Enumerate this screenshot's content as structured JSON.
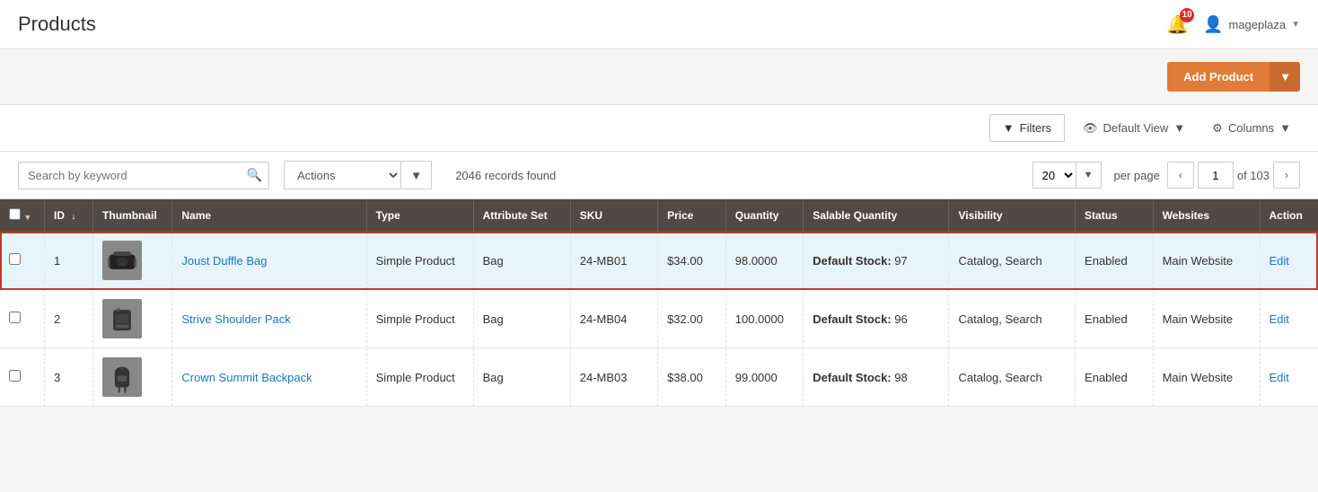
{
  "header": {
    "title": "Products",
    "notification_count": "10",
    "username": "mageplaza"
  },
  "toolbar": {
    "add_product_label": "Add Product"
  },
  "grid_controls": {
    "filters_label": "Filters",
    "default_view_label": "Default View",
    "columns_label": "Columns"
  },
  "search": {
    "placeholder": "Search by keyword"
  },
  "actions": {
    "label": "Actions",
    "options": [
      "Actions"
    ]
  },
  "records": {
    "count_label": "2046 records found"
  },
  "pagination": {
    "per_page": "20",
    "per_page_label": "per page",
    "current_page": "1",
    "total_pages": "of 103"
  },
  "table": {
    "columns": [
      "",
      "ID",
      "Thumbnail",
      "Name",
      "Type",
      "Attribute Set",
      "SKU",
      "Price",
      "Quantity",
      "Salable Quantity",
      "Visibility",
      "Status",
      "Websites",
      "Action"
    ],
    "rows": [
      {
        "id": "1",
        "thumbnail_alt": "Joust Duffle Bag thumbnail",
        "name": "Joust Duffle Bag",
        "type": "Simple Product",
        "attribute_set": "Bag",
        "sku": "24-MB01",
        "price": "$34.00",
        "quantity": "98.0000",
        "salable_quantity_label": "Default Stock:",
        "salable_quantity_value": "97",
        "visibility": "Catalog, Search",
        "status": "Enabled",
        "websites": "Main Website",
        "action": "Edit",
        "highlighted": true
      },
      {
        "id": "2",
        "thumbnail_alt": "Strive Shoulder Pack thumbnail",
        "name": "Strive Shoulder Pack",
        "type": "Simple Product",
        "attribute_set": "Bag",
        "sku": "24-MB04",
        "price": "$32.00",
        "quantity": "100.0000",
        "salable_quantity_label": "Default Stock:",
        "salable_quantity_value": "96",
        "visibility": "Catalog, Search",
        "status": "Enabled",
        "websites": "Main Website",
        "action": "Edit",
        "highlighted": false
      },
      {
        "id": "3",
        "thumbnail_alt": "Crown Summit Backpack thumbnail",
        "name": "Crown Summit Backpack",
        "type": "Simple Product",
        "attribute_set": "Bag",
        "sku": "24-MB03",
        "price": "$38.00",
        "quantity": "99.0000",
        "salable_quantity_label": "Default Stock:",
        "salable_quantity_value": "98",
        "visibility": "Catalog, Search",
        "status": "Enabled",
        "websites": "Main Website",
        "action": "Edit",
        "highlighted": false
      }
    ]
  },
  "colors": {
    "add_product_btn": "#e07b39",
    "header_bg": "#514943",
    "highlight_border": "#c0392b",
    "highlight_bg": "#e8f4fb",
    "link_color": "#1979c3"
  }
}
